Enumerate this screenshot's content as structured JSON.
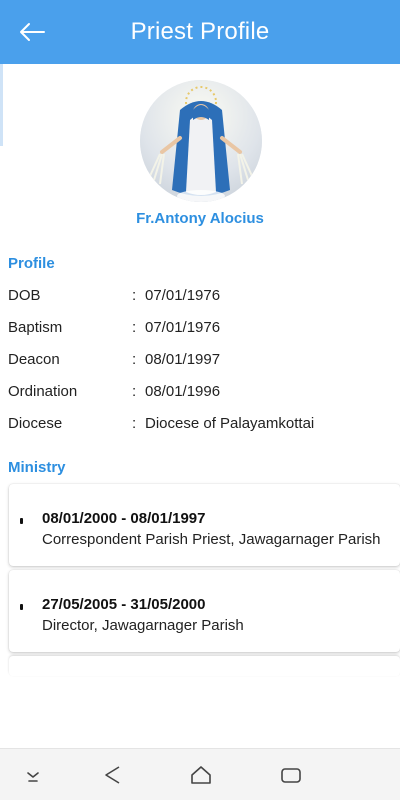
{
  "header": {
    "title": "Priest Profile",
    "back_icon": "arrow-left-icon"
  },
  "colors": {
    "primary": "#4aa0ec",
    "accent_text": "#2d8fe0"
  },
  "priest": {
    "name": "Fr.Antony Alocius"
  },
  "profile": {
    "section_title": "Profile",
    "fields": [
      {
        "label": "DOB",
        "value": "07/01/1976"
      },
      {
        "label": "Baptism",
        "value": "07/01/1976"
      },
      {
        "label": "Deacon",
        "value": "08/01/1997"
      },
      {
        "label": "Ordination",
        "value": "08/01/1996"
      },
      {
        "label": "Diocese",
        "value": "Diocese of Palayamkottai"
      }
    ]
  },
  "ministry": {
    "section_title": "Ministry",
    "items": [
      {
        "dates": "08/01/2000 - 08/01/1997",
        "role": "Correspondent Parish Priest, Jawagarnager Parish"
      },
      {
        "dates": "27/05/2005 - 31/05/2000",
        "role": "Director, Jawagarnager Parish"
      }
    ]
  },
  "navbar": {
    "icons": [
      "chevron-down-icon",
      "back-triangle-icon",
      "home-icon",
      "recents-icon"
    ]
  }
}
